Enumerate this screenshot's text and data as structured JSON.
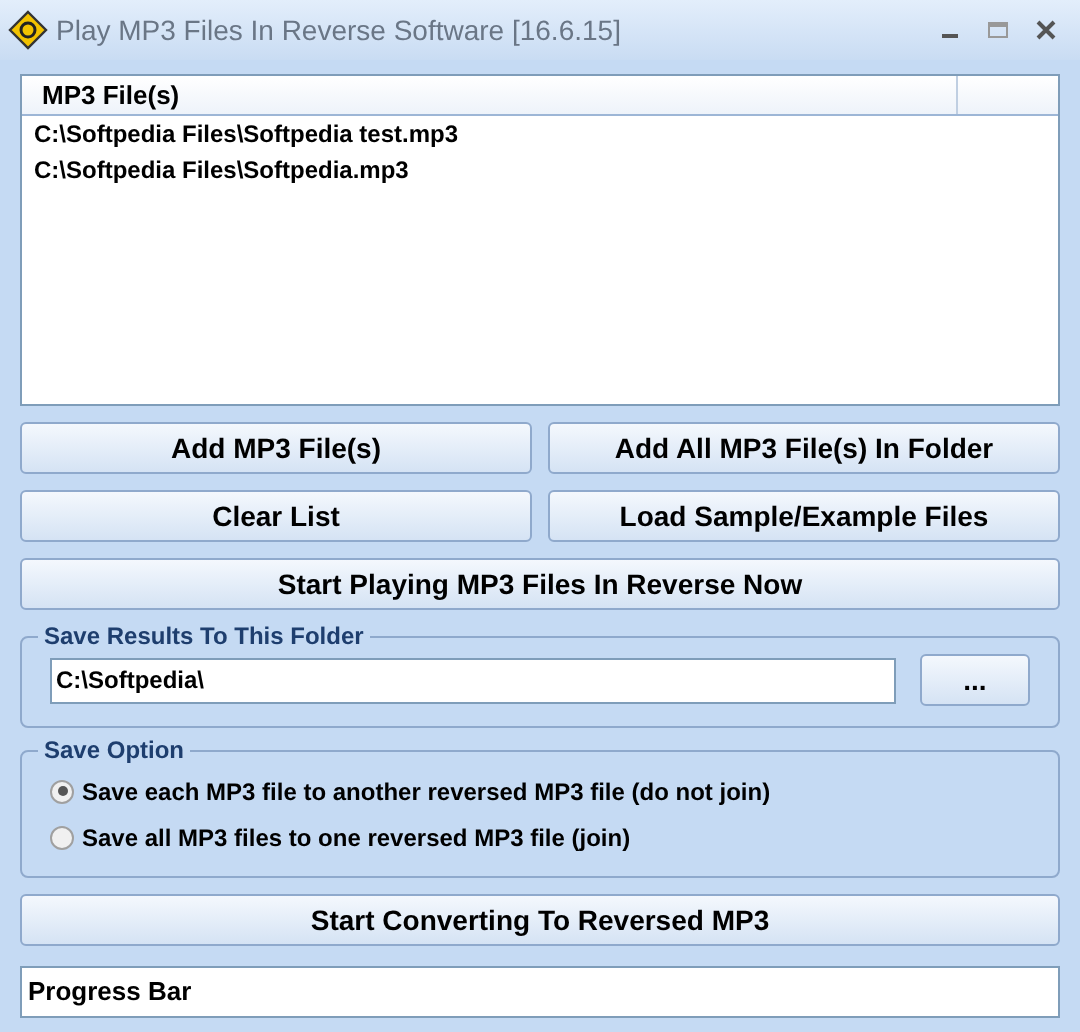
{
  "window": {
    "title": "Play MP3 Files In Reverse Software [16.6.15]"
  },
  "file_list": {
    "columns": [
      "MP3 File(s)"
    ],
    "rows": [
      "C:\\Softpedia Files\\Softpedia test.mp3",
      "C:\\Softpedia Files\\Softpedia.mp3"
    ]
  },
  "button_rows": [
    [
      "Add MP3 File(s)",
      "Add All MP3 File(s) In Folder"
    ],
    [
      "Clear List",
      "Load Sample/Example Files"
    ],
    [
      "Start Playing MP3 Files In Reverse Now"
    ]
  ],
  "save_folder": {
    "label": "Save Results To This Folder",
    "value": "C:\\Softpedia\\",
    "browse": "..."
  },
  "save_option": {
    "label": "Save Option",
    "options": [
      {
        "label": "Save each MP3 file to another reversed MP3 file (do not join)",
        "selected": true
      },
      {
        "label": "Save all MP3 files to one reversed MP3 file (join)",
        "selected": false
      }
    ]
  },
  "convert_button": "Start Converting To Reversed MP3",
  "progress": {
    "label": "Progress Bar"
  }
}
